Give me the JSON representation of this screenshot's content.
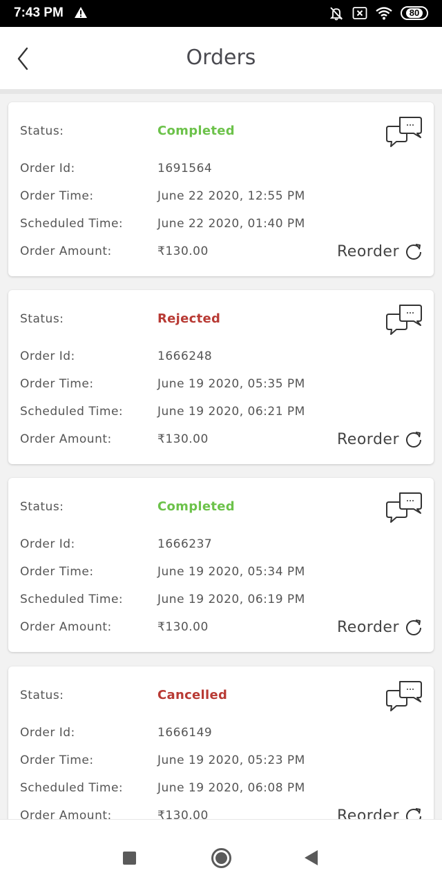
{
  "statusbar": {
    "time": "7:43 PM",
    "battery": "80",
    "icons": [
      "warning-icon",
      "bell-muted-icon",
      "sim-x-icon",
      "wifi-icon",
      "battery-icon"
    ]
  },
  "appbar": {
    "title": "Orders",
    "back_icon": "chevron-left-icon"
  },
  "labels": {
    "status": "Status:",
    "order_id": "Order Id:",
    "order_time": "Order Time:",
    "scheduled_time": "Scheduled Time:",
    "order_amount": "Order Amount:",
    "reorder": "Reorder"
  },
  "colors": {
    "completed": "#6cc24a",
    "rejected": "#b83a34",
    "cancelled": "#b83a34"
  },
  "orders": [
    {
      "status": "Completed",
      "order_id": "1691564",
      "order_time": "June 22 2020, 12:55 PM",
      "scheduled_time": "June 22 2020, 01:40 PM",
      "order_amount": "₹130.00"
    },
    {
      "status": "Rejected",
      "order_id": "1666248",
      "order_time": "June 19 2020, 05:35 PM",
      "scheduled_time": "June 19 2020, 06:21 PM",
      "order_amount": "₹130.00"
    },
    {
      "status": "Completed",
      "order_id": "1666237",
      "order_time": "June 19 2020, 05:34 PM",
      "scheduled_time": "June 19 2020, 06:19 PM",
      "order_amount": "₹130.00"
    },
    {
      "status": "Cancelled",
      "order_id": "1666149",
      "order_time": "June 19 2020, 05:23 PM",
      "scheduled_time": "June 19 2020, 06:08 PM",
      "order_amount": "₹130.00"
    }
  ],
  "navbar": {
    "icons": [
      "recents-square-icon",
      "home-circle-icon",
      "back-triangle-icon"
    ]
  }
}
